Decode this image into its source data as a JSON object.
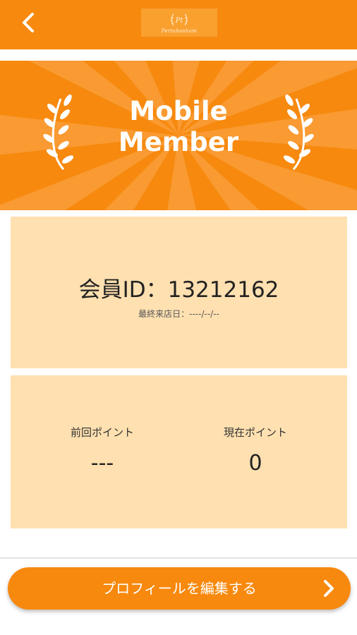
{
  "header": {
    "back_icon": "chevron-left-icon",
    "logo_script": "Pertuhashum"
  },
  "banner": {
    "title_line1": "Mobile",
    "title_line2": "Member",
    "decoration_icon": "laurel-icon"
  },
  "member": {
    "id_text": "会員ID：13212162",
    "last_visit": "最終来店日：----/--/--"
  },
  "points": {
    "previous_label": "前回ポイント",
    "previous_value": "---",
    "current_label": "現在ポイント",
    "current_value": "0"
  },
  "footer": {
    "edit_button_label": "プロフィールを編集する",
    "edit_button_icon": "chevron-right-icon"
  },
  "colors": {
    "brand_orange": "#f7890e",
    "card_background": "#ffe0b0"
  }
}
